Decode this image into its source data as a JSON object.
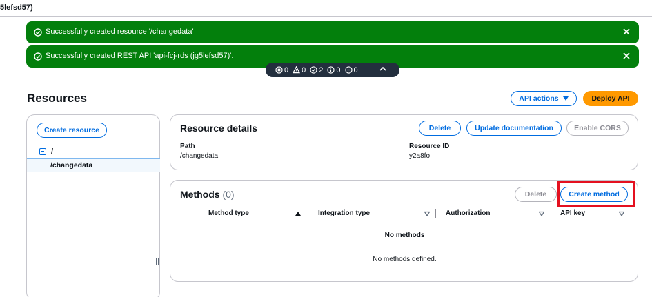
{
  "header": {
    "breadcrumb": "5lefsd57)"
  },
  "flashbar": [
    {
      "type": "success",
      "message": "Successfully created resource '/changedata'"
    },
    {
      "type": "success",
      "message": "Successfully created REST API 'api-fcj-rds (jg5lefsd57)'."
    }
  ],
  "notification_counts": {
    "error": "0",
    "warning": "0",
    "success": "2",
    "info": "0",
    "in_progress": "0"
  },
  "page": {
    "title": "Resources"
  },
  "actions": {
    "api_actions_label": "API actions",
    "deploy_label": "Deploy API"
  },
  "resource_tree": {
    "create_label": "Create resource",
    "root": "/",
    "selected": "/changedata"
  },
  "resource_details": {
    "title": "Resource details",
    "delete_label": "Delete",
    "update_label": "Update documentation",
    "cors_label": "Enable CORS",
    "path_label": "Path",
    "path_value": "/changedata",
    "id_label": "Resource ID",
    "id_value": "y2a8fo"
  },
  "methods": {
    "title": "Methods",
    "count": "(0)",
    "delete_label": "Delete",
    "create_label": "Create method",
    "columns": [
      "Method type",
      "Integration type",
      "Authorization",
      "API key"
    ],
    "empty_title": "No methods",
    "empty_message": "No methods defined."
  },
  "colors": {
    "success": "#037f0c",
    "primary": "#006ce0",
    "accent": "#ff9900",
    "highlight": "#e4101f",
    "notification_bar": "#232f3e"
  }
}
